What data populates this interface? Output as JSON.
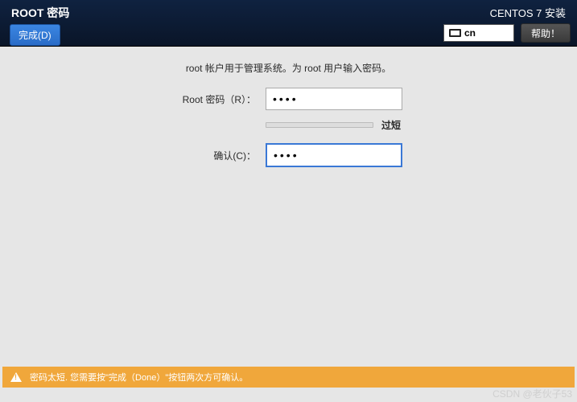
{
  "header": {
    "title": "ROOT 密码",
    "done_button": "完成(D)",
    "installer_title": "CENTOS 7 安装",
    "keyboard_layout": "cn",
    "help_button": "帮助！"
  },
  "form": {
    "instruction": "root 帐户用于管理系统。为 root 用户输入密码。",
    "password_label": "Root 密码（R）：",
    "password_value": "••••",
    "strength_label": "过短",
    "confirm_label": "确认(C)：",
    "confirm_value": "••••"
  },
  "warning": {
    "message": "密码太短. 您需要按\"完成（Done）\"按钮两次方可确认。"
  },
  "watermark": "CSDN @老伙子53"
}
